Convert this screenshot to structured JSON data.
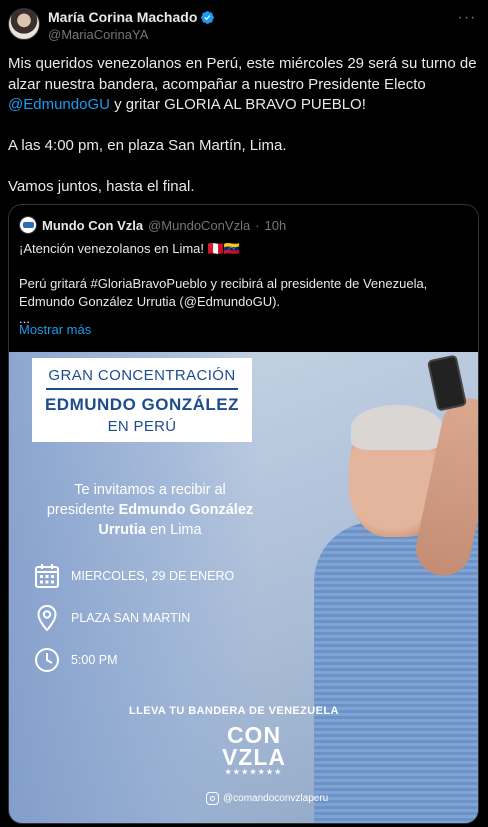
{
  "author": {
    "name": "María Corina Machado",
    "handle": "@MariaCorinaYA",
    "verified": true,
    "more_icon": "more-horizontal-icon"
  },
  "tweet": {
    "line1_text": "Mis queridos venezolanos en Perú, este miércoles 29 será su turno de alzar nuestra bandera, acompañar a nuestro Presidente Electo ",
    "mention": "@EdmundoGU",
    "line1_tail": " y gritar GLORIA AL BRAVO PUEBLO!",
    "paragraph2": "A las 4:00 pm, en plaza San Martín, Lima.",
    "paragraph3": "Vamos juntos, hasta el final."
  },
  "quoted": {
    "name": "Mundo Con Vzla",
    "handle": "@MundoConVzla",
    "separator": "·",
    "time": "10h",
    "line1": "¡Atención venezolanos en Lima! 🇵🇪🇻🇪",
    "line2": "Perú gritará #GloriaBravoPueblo y recibirá al presidente de Venezuela,",
    "line3": "Edmundo González Urrutia (@EdmundoGU).",
    "line4": "...",
    "show_more": "Mostrar más"
  },
  "poster": {
    "title_1": "GRAN CONCENTRACIÓN",
    "title_2": "EDMUNDO GONZÁLEZ",
    "title_3": "EN PERÚ",
    "invite_1": "Te invitamos a recibir al",
    "invite_2a": "presidente ",
    "invite_2b": "Edmundo González",
    "invite_3a": "Urrutia",
    "invite_3b": " en Lima",
    "date": "MIERCOLES, 29 DE ENERO",
    "place": "PLAZA SAN MARTIN",
    "time": "5:00 PM",
    "bring_flag": "LLEVA TU BANDERA DE VENEZUELA",
    "brand_1": "CON",
    "brand_2": "VZLA",
    "brand_stars": "★★★★★★★",
    "instagram": "@comandoconvzlaperu"
  },
  "colors": {
    "background": "#000000",
    "text": "#e7e9ea",
    "muted": "#71767b",
    "link": "#1d9bf0",
    "border": "#2f3336",
    "poster_blue": "#1e4c8c"
  }
}
